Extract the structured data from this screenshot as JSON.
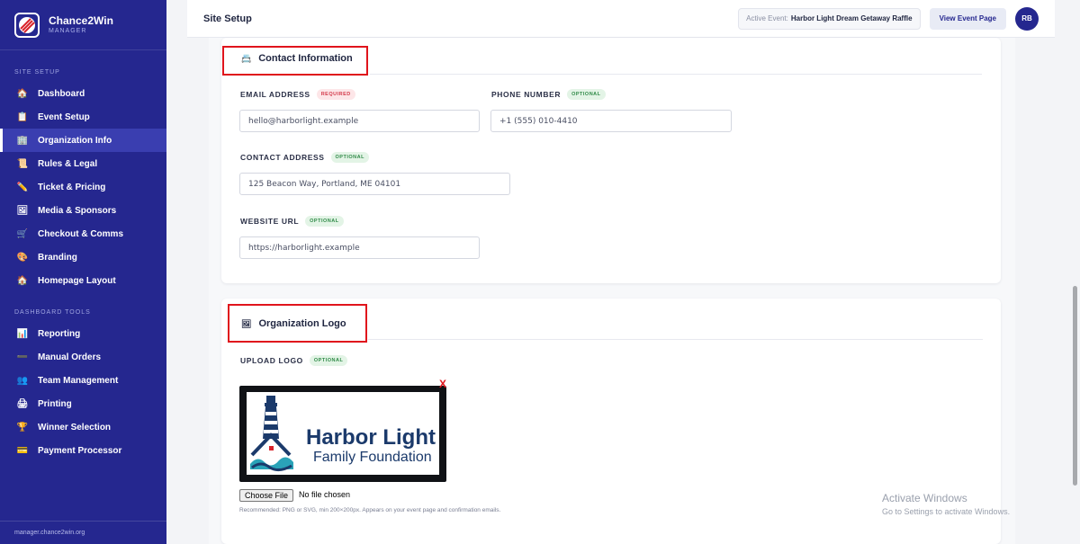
{
  "brand": {
    "name": "Chance2Win",
    "sub": "MANAGER"
  },
  "sidebar": {
    "section1": "SITE SETUP",
    "section2": "DASHBOARD TOOLS",
    "items": [
      {
        "label": "Dashboard",
        "icon": "🏠"
      },
      {
        "label": "Event Setup",
        "icon": "📋"
      },
      {
        "label": "Organization Info",
        "icon": "🏢"
      },
      {
        "label": "Rules & Legal",
        "icon": "📜"
      },
      {
        "label": "Ticket & Pricing",
        "icon": "✏️"
      },
      {
        "label": "Media & Sponsors",
        "icon": "🖼"
      },
      {
        "label": "Checkout & Comms",
        "icon": "🛒"
      },
      {
        "label": "Branding",
        "icon": "🎨"
      },
      {
        "label": "Homepage Layout",
        "icon": "🏠"
      },
      {
        "label": "Reporting",
        "icon": "📊"
      },
      {
        "label": "Manual Orders",
        "icon": "➖"
      },
      {
        "label": "Team Management",
        "icon": "👥"
      },
      {
        "label": "Printing",
        "icon": "🖨"
      },
      {
        "label": "Winner Selection",
        "icon": "🏆"
      },
      {
        "label": "Payment Processor",
        "icon": "💳"
      }
    ],
    "footer": "manager.chance2win.org"
  },
  "header": {
    "title": "Site Setup",
    "active_event_label": "Active Event:",
    "active_event_name": "Harbor Light Dream Getaway Raffle",
    "view_button": "View Event Page",
    "avatar_initials": "RB"
  },
  "contact": {
    "title": "Contact Information",
    "icon": "📇",
    "email_label": "EMAIL ADDRESS",
    "email_badge": "REQUIRED",
    "email_value": "hello@harborlight.example",
    "phone_label": "PHONE NUMBER",
    "phone_badge": "OPTIONAL",
    "phone_value": "+1 (555) 010-4410",
    "address_label": "CONTACT ADDRESS",
    "address_badge": "OPTIONAL",
    "address_value": "125 Beacon Way, Portland, ME 04101",
    "website_label": "WEBSITE URL",
    "website_badge": "OPTIONAL",
    "website_value": "https://harborlight.example"
  },
  "logo": {
    "title": "Organization Logo",
    "icon": "🖼",
    "upload_label": "UPLOAD LOGO",
    "upload_badge": "OPTIONAL",
    "remove_label": "X",
    "logo_line1": "Harbor Light",
    "logo_line2": "Family Foundation",
    "file_button": "Choose File",
    "file_status": "No file chosen",
    "hint": "Recommended: PNG or SVG, min 200×200px. Appears on your event page and confirmation emails."
  },
  "watermark": {
    "line1": "Activate Windows",
    "line2": "Go to Settings to activate Windows."
  },
  "colors": {
    "sidebar": "#25278f",
    "highlight": "#e0141c",
    "required": "#d33a4b",
    "optional": "#2f8a47"
  }
}
